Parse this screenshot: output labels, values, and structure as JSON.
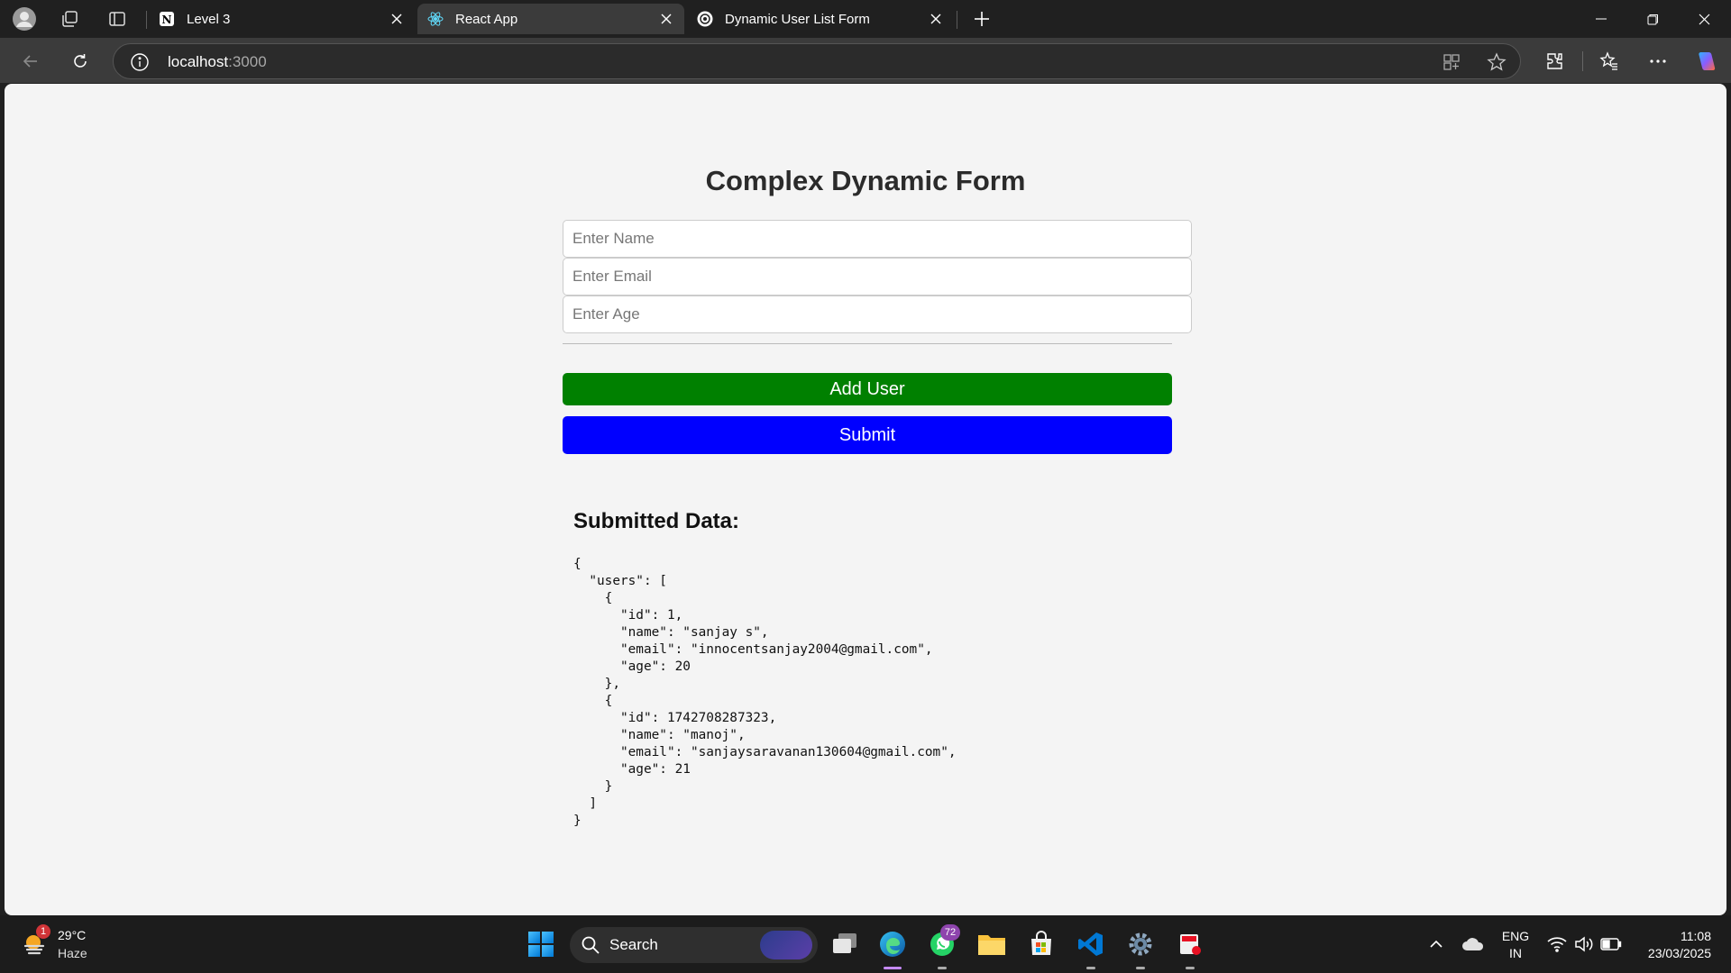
{
  "browser": {
    "tabs": [
      {
        "title": "Level 3",
        "favicon": "notion-icon",
        "active": false
      },
      {
        "title": "React App",
        "favicon": "react-icon",
        "active": true
      },
      {
        "title": "Dynamic User List Form",
        "favicon": "openai-icon",
        "active": false
      }
    ],
    "address": {
      "host": "localhost",
      "port": ":3000"
    }
  },
  "page": {
    "title": "Complex Dynamic Form",
    "fields": {
      "name_placeholder": "Enter Name",
      "email_placeholder": "Enter Email",
      "age_placeholder": "Enter Age"
    },
    "buttons": {
      "add_user": "Add User",
      "submit": "Submit"
    },
    "colors": {
      "add_user": "#008000",
      "submit": "#0000ff",
      "background": "#f4f4f4"
    },
    "submitted_heading": "Submitted Data:",
    "submitted_json": "{\n  \"users\": [\n    {\n      \"id\": 1,\n      \"name\": \"sanjay s\",\n      \"email\": \"innocentsanjay2004@gmail.com\",\n      \"age\": 20\n    },\n    {\n      \"id\": 1742708287323,\n      \"name\": \"manoj\",\n      \"email\": \"sanjaysaravanan130604@gmail.com\",\n      \"age\": 21\n    }\n  ]\n}"
  },
  "taskbar": {
    "weather": {
      "temp": "29°C",
      "desc": "Haze",
      "badge": "1"
    },
    "search_label": "Search",
    "whatsapp_badge": "72",
    "language": {
      "line1": "ENG",
      "line2": "IN"
    },
    "clock": {
      "time": "11:08",
      "date": "23/03/2025"
    }
  }
}
